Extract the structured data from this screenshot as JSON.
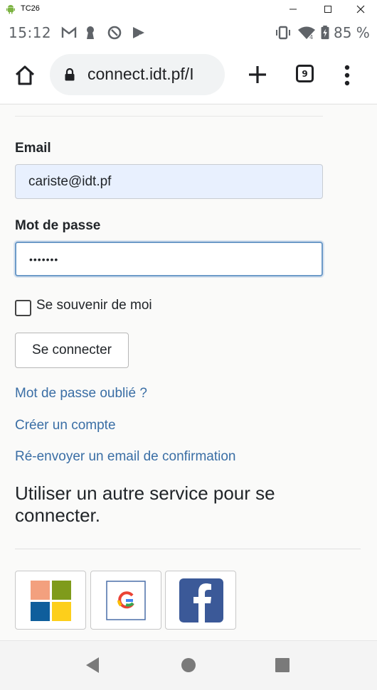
{
  "window": {
    "title": "TC26"
  },
  "status_bar": {
    "time": "15:12",
    "battery": "85 %"
  },
  "browser": {
    "url": "connect.idt.pf/I",
    "tab_count": "9"
  },
  "form": {
    "email_label": "Email",
    "email_value": "cariste@idt.pf",
    "password_label": "Mot de passe",
    "password_value": "•••••••",
    "remember_label": "Se souvenir de moi",
    "remember_checked": false,
    "submit_label": "Se connecter"
  },
  "links": {
    "forgot": "Mot de passe oublié ?",
    "register": "Créer un compte",
    "resend": "Ré-envoyer un email de confirmation"
  },
  "external": {
    "heading": "Utiliser un autre service pour se connecter.",
    "providers": [
      "microsoft",
      "google",
      "facebook"
    ]
  },
  "colors": {
    "link": "#3a6ea5",
    "autofill": "#e8f0fe",
    "facebook": "#3b5998"
  }
}
